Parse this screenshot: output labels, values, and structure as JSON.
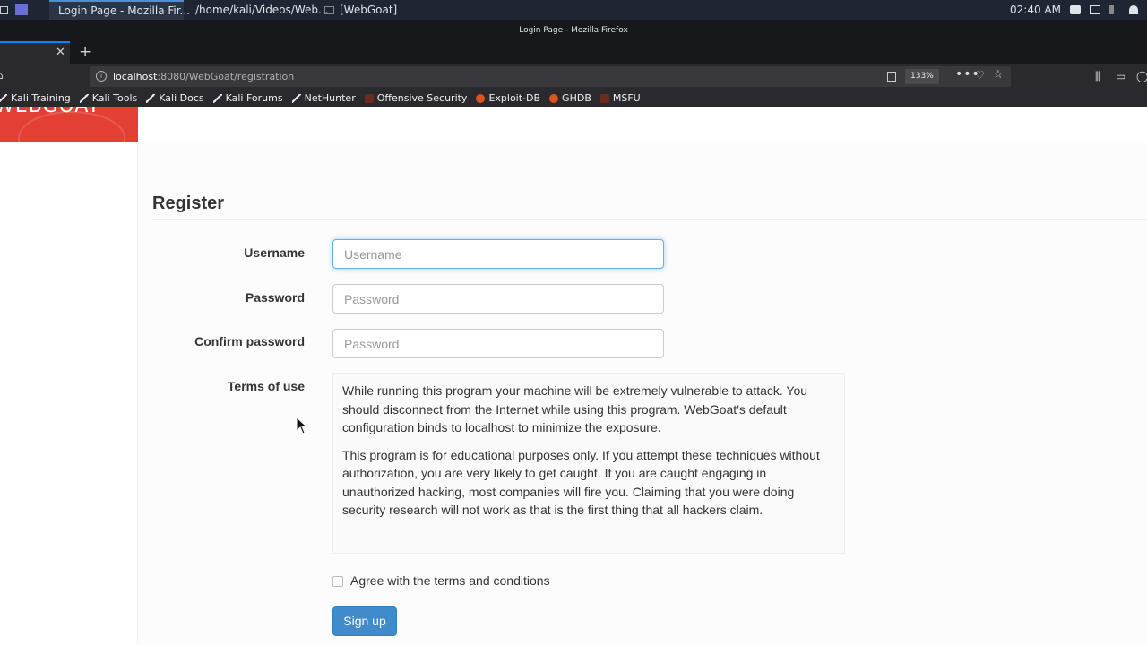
{
  "taskbar": {
    "tasks": [
      {
        "label": "Login Page - Mozilla Fir..."
      },
      {
        "label": "/home/kali/Videos/Web..."
      },
      {
        "label": "[WebGoat]"
      }
    ],
    "clock": "02:40 AM"
  },
  "window": {
    "title": "Login Page - Mozilla Firefox"
  },
  "browser": {
    "url_host": "localhost",
    "url_rest": ":8080/WebGoat/registration",
    "zoom": "133%",
    "bookmarks": [
      {
        "label": "Kali Training",
        "icon": "kali-dragon-icon"
      },
      {
        "label": "Kali Tools",
        "icon": "kali-dragon-icon"
      },
      {
        "label": "Kali Docs",
        "icon": "kali-dragon-icon"
      },
      {
        "label": "Kali Forums",
        "icon": "kali-dragon-icon"
      },
      {
        "label": "NetHunter",
        "icon": "kali-dragon-icon"
      },
      {
        "label": "Offensive Security",
        "icon": "offsec-icon"
      },
      {
        "label": "Exploit-DB",
        "icon": "exploit-db-icon"
      },
      {
        "label": "GHDB",
        "icon": "exploit-db-icon"
      },
      {
        "label": "MSFU",
        "icon": "offsec-icon"
      }
    ]
  },
  "page": {
    "logo_text": "WEBGOAT",
    "heading": "Register",
    "form": {
      "username_label": "Username",
      "username_placeholder": "Username",
      "password_label": "Password",
      "password_placeholder": "Password",
      "confirm_label": "Confirm password",
      "confirm_placeholder": "Password",
      "terms_label": "Terms of use",
      "terms_p1": "While running this program your machine will be extremely vulnerable to attack. You should disconnect from the Internet while using this program. WebGoat's default configuration binds to localhost to minimize the exposure.",
      "terms_p2": "This program is for educational purposes only. If you attempt these techniques without authorization, you are very likely to get caught. If you are caught engaging in unauthorized hacking, most companies will fire you. Claiming that you were doing security research will not work as that is the first thing that all hackers claim.",
      "agree_label": "Agree with the terms and conditions",
      "submit_label": "Sign up"
    }
  },
  "colors": {
    "logo_red": "#e33f34",
    "primary_button": "#428bca",
    "focus_border": "#66afe9"
  }
}
